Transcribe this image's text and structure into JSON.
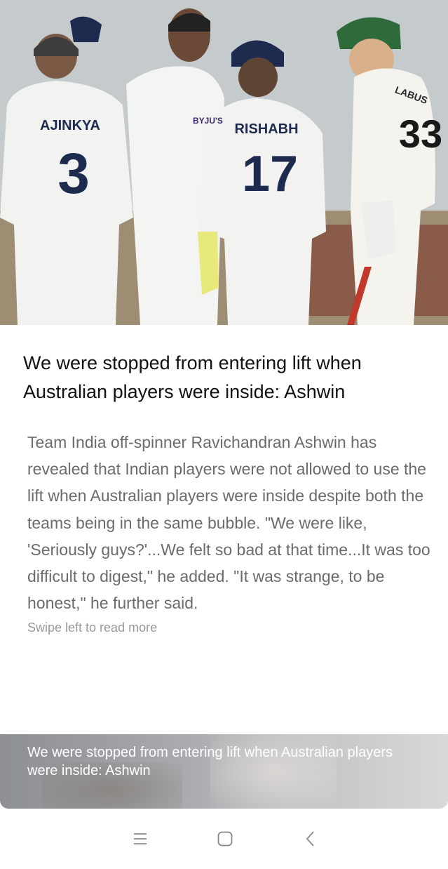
{
  "hero": {
    "image_icon": "cricket-players-photo",
    "jersey_left_name": "AJINKYA",
    "jersey_left_number": "3",
    "jersey_mid_name": "RISHABH",
    "jersey_mid_number": "17",
    "jersey_right_name": "LABUS",
    "jersey_right_number": "33",
    "sponsor": "BYJU'S"
  },
  "article": {
    "headline": "We were stopped from entering lift when Australian players were inside: Ashwin",
    "summary": "Team India off-spinner Ravichandran Ashwin has revealed that Indian players were not allowed to use the lift when Australian players were inside despite both the teams being in the same bubble. \"We were like, 'Seriously guys?'...We felt so bad at that time...It was too difficult to digest,\" he added. \"It was strange, to be honest,\" he further said.",
    "swipe_hint": "Swipe left to read more"
  },
  "next_card": {
    "title": "We were stopped from entering lift when Australian players were inside: Ashwin"
  },
  "navbar": {
    "menu_icon": "menu-icon",
    "home_icon": "home-icon",
    "back_icon": "back-icon"
  },
  "colors": {
    "headline": "#111111",
    "summary": "#6b6b6b",
    "hint": "#9a9a9a",
    "jersey": "#f2f2f0",
    "indian_cap": "#1d2b4f",
    "aus_helmet": "#2f6b3a"
  }
}
